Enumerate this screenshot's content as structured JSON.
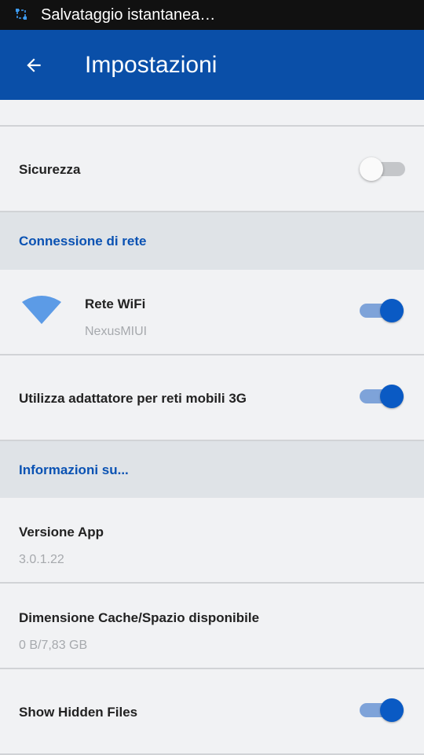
{
  "status_bar": {
    "notification_text": "Salvataggio istantanea…"
  },
  "app_bar": {
    "title": "Impostazioni"
  },
  "settings": {
    "security": {
      "label": "Sicurezza",
      "enabled": false
    },
    "network_section": {
      "header": "Connessione di rete"
    },
    "wifi": {
      "label": "Rete WiFi",
      "value": "NexusMIUI",
      "enabled": true
    },
    "mobile_3g": {
      "label": "Utilizza adattatore per reti mobili 3G",
      "enabled": true
    },
    "info_section": {
      "header": "Informazioni su..."
    },
    "app_version": {
      "label": "Versione App",
      "value": "3.0.1.22"
    },
    "cache": {
      "label": "Dimensione Cache/Spazio disponibile",
      "value": "0 B/7,83 GB"
    },
    "hidden_files": {
      "label": "Show Hidden Files",
      "enabled": true
    }
  },
  "colors": {
    "app_bar": "#0a4fa8",
    "accent": "#0a5ac4",
    "section_header_text": "#0a52b3",
    "section_header_bg": "#dfe3e7",
    "wifi_icon": "#5c9be6"
  }
}
